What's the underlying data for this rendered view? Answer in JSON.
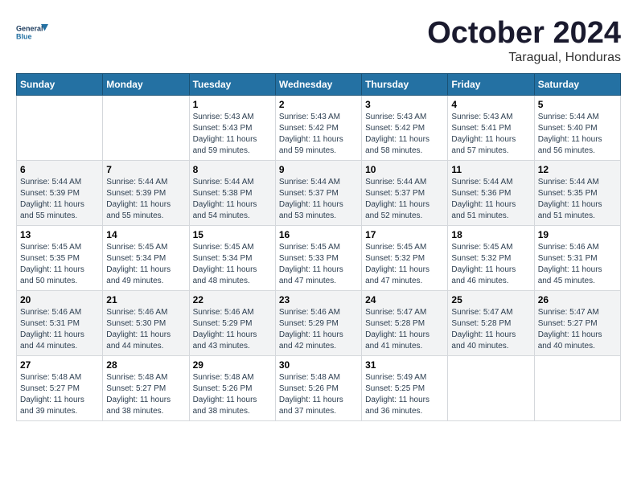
{
  "header": {
    "logo_line1": "General",
    "logo_line2": "Blue",
    "month": "October 2024",
    "location": "Taragual, Honduras"
  },
  "weekdays": [
    "Sunday",
    "Monday",
    "Tuesday",
    "Wednesday",
    "Thursday",
    "Friday",
    "Saturday"
  ],
  "weeks": [
    [
      {
        "day": "",
        "info": ""
      },
      {
        "day": "",
        "info": ""
      },
      {
        "day": "1",
        "info": "Sunrise: 5:43 AM\nSunset: 5:43 PM\nDaylight: 11 hours and 59 minutes."
      },
      {
        "day": "2",
        "info": "Sunrise: 5:43 AM\nSunset: 5:42 PM\nDaylight: 11 hours and 59 minutes."
      },
      {
        "day": "3",
        "info": "Sunrise: 5:43 AM\nSunset: 5:42 PM\nDaylight: 11 hours and 58 minutes."
      },
      {
        "day": "4",
        "info": "Sunrise: 5:43 AM\nSunset: 5:41 PM\nDaylight: 11 hours and 57 minutes."
      },
      {
        "day": "5",
        "info": "Sunrise: 5:44 AM\nSunset: 5:40 PM\nDaylight: 11 hours and 56 minutes."
      }
    ],
    [
      {
        "day": "6",
        "info": "Sunrise: 5:44 AM\nSunset: 5:39 PM\nDaylight: 11 hours and 55 minutes."
      },
      {
        "day": "7",
        "info": "Sunrise: 5:44 AM\nSunset: 5:39 PM\nDaylight: 11 hours and 55 minutes."
      },
      {
        "day": "8",
        "info": "Sunrise: 5:44 AM\nSunset: 5:38 PM\nDaylight: 11 hours and 54 minutes."
      },
      {
        "day": "9",
        "info": "Sunrise: 5:44 AM\nSunset: 5:37 PM\nDaylight: 11 hours and 53 minutes."
      },
      {
        "day": "10",
        "info": "Sunrise: 5:44 AM\nSunset: 5:37 PM\nDaylight: 11 hours and 52 minutes."
      },
      {
        "day": "11",
        "info": "Sunrise: 5:44 AM\nSunset: 5:36 PM\nDaylight: 11 hours and 51 minutes."
      },
      {
        "day": "12",
        "info": "Sunrise: 5:44 AM\nSunset: 5:35 PM\nDaylight: 11 hours and 51 minutes."
      }
    ],
    [
      {
        "day": "13",
        "info": "Sunrise: 5:45 AM\nSunset: 5:35 PM\nDaylight: 11 hours and 50 minutes."
      },
      {
        "day": "14",
        "info": "Sunrise: 5:45 AM\nSunset: 5:34 PM\nDaylight: 11 hours and 49 minutes."
      },
      {
        "day": "15",
        "info": "Sunrise: 5:45 AM\nSunset: 5:34 PM\nDaylight: 11 hours and 48 minutes."
      },
      {
        "day": "16",
        "info": "Sunrise: 5:45 AM\nSunset: 5:33 PM\nDaylight: 11 hours and 47 minutes."
      },
      {
        "day": "17",
        "info": "Sunrise: 5:45 AM\nSunset: 5:32 PM\nDaylight: 11 hours and 47 minutes."
      },
      {
        "day": "18",
        "info": "Sunrise: 5:45 AM\nSunset: 5:32 PM\nDaylight: 11 hours and 46 minutes."
      },
      {
        "day": "19",
        "info": "Sunrise: 5:46 AM\nSunset: 5:31 PM\nDaylight: 11 hours and 45 minutes."
      }
    ],
    [
      {
        "day": "20",
        "info": "Sunrise: 5:46 AM\nSunset: 5:31 PM\nDaylight: 11 hours and 44 minutes."
      },
      {
        "day": "21",
        "info": "Sunrise: 5:46 AM\nSunset: 5:30 PM\nDaylight: 11 hours and 44 minutes."
      },
      {
        "day": "22",
        "info": "Sunrise: 5:46 AM\nSunset: 5:29 PM\nDaylight: 11 hours and 43 minutes."
      },
      {
        "day": "23",
        "info": "Sunrise: 5:46 AM\nSunset: 5:29 PM\nDaylight: 11 hours and 42 minutes."
      },
      {
        "day": "24",
        "info": "Sunrise: 5:47 AM\nSunset: 5:28 PM\nDaylight: 11 hours and 41 minutes."
      },
      {
        "day": "25",
        "info": "Sunrise: 5:47 AM\nSunset: 5:28 PM\nDaylight: 11 hours and 40 minutes."
      },
      {
        "day": "26",
        "info": "Sunrise: 5:47 AM\nSunset: 5:27 PM\nDaylight: 11 hours and 40 minutes."
      }
    ],
    [
      {
        "day": "27",
        "info": "Sunrise: 5:48 AM\nSunset: 5:27 PM\nDaylight: 11 hours and 39 minutes."
      },
      {
        "day": "28",
        "info": "Sunrise: 5:48 AM\nSunset: 5:27 PM\nDaylight: 11 hours and 38 minutes."
      },
      {
        "day": "29",
        "info": "Sunrise: 5:48 AM\nSunset: 5:26 PM\nDaylight: 11 hours and 38 minutes."
      },
      {
        "day": "30",
        "info": "Sunrise: 5:48 AM\nSunset: 5:26 PM\nDaylight: 11 hours and 37 minutes."
      },
      {
        "day": "31",
        "info": "Sunrise: 5:49 AM\nSunset: 5:25 PM\nDaylight: 11 hours and 36 minutes."
      },
      {
        "day": "",
        "info": ""
      },
      {
        "day": "",
        "info": ""
      }
    ]
  ]
}
